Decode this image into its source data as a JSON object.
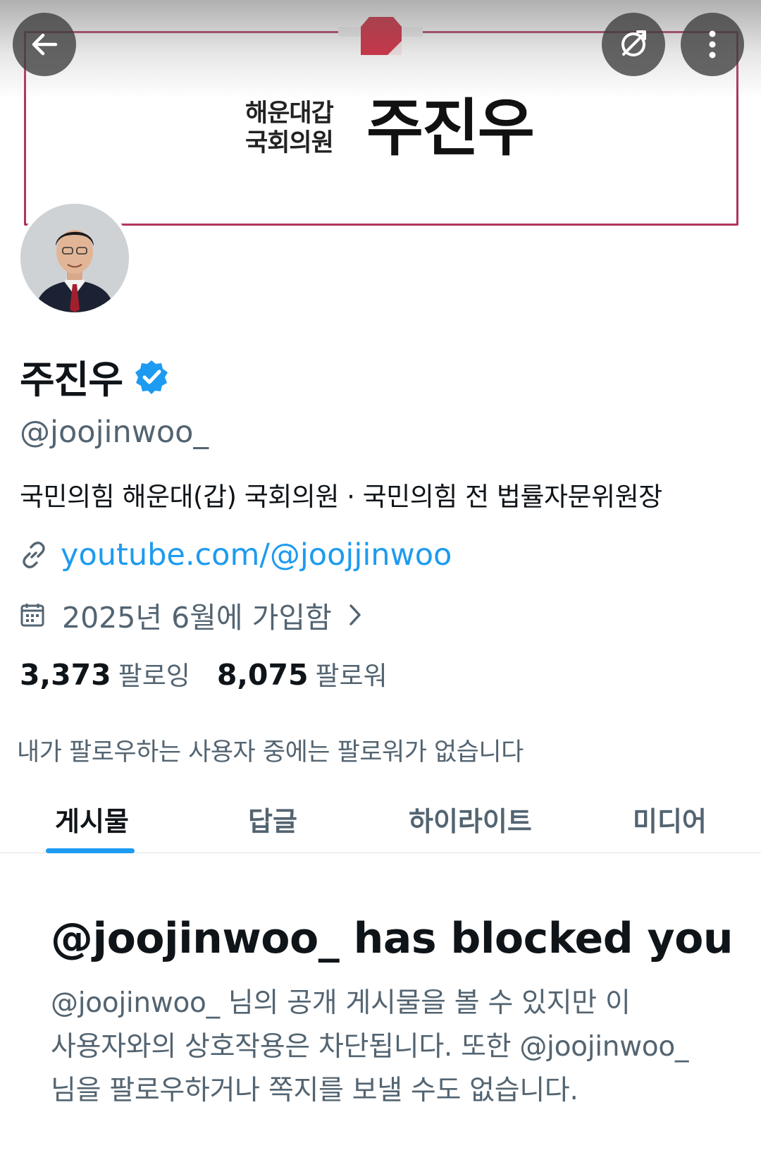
{
  "banner": {
    "subtitle_line1": "해운대갑",
    "subtitle_line2": "국회의원",
    "name": "주진우",
    "frame_color": "#b0355a",
    "logo_color": "#d0152c"
  },
  "toolbar": {
    "back_icon": "arrow-left-icon",
    "translate_icon": "globe-slash-icon",
    "more_icon": "more-vertical-icon"
  },
  "profile": {
    "display_name": "주진우",
    "verified": true,
    "handle": "@joojinwoo_",
    "bio": "국민의힘 해운대(갑) 국회의원 · 국민의힘 전 법률자문위원장",
    "link": "youtube.com/@joojjinwoo",
    "joined": "2025년 6월에 가입함",
    "following_count": "3,373",
    "following_label": "팔로잉",
    "followers_count": "8,075",
    "followers_label": "팔로워",
    "mutual_text": "내가 팔로우하는 사용자 중에는 팔로워가 없습니다"
  },
  "tabs": [
    {
      "label": "게시물",
      "active": true
    },
    {
      "label": "답글",
      "active": false
    },
    {
      "label": "하이라이트",
      "active": false
    },
    {
      "label": "미디어",
      "active": false
    }
  ],
  "blocked": {
    "title": "@joojinwoo_ has blocked you",
    "line1": "@joojinwoo_ 님의 공개 게시물을 볼 수 있지만 이",
    "line2": "사용자와의 상호작용은 차단됩니다. 또한 @joojinwoo_",
    "line3": "님을 팔로우하거나 쪽지를 보낼 수도 없습니다."
  },
  "colors": {
    "accent": "#1d9bf0",
    "text_primary": "#0f1419",
    "text_secondary": "#536471"
  }
}
